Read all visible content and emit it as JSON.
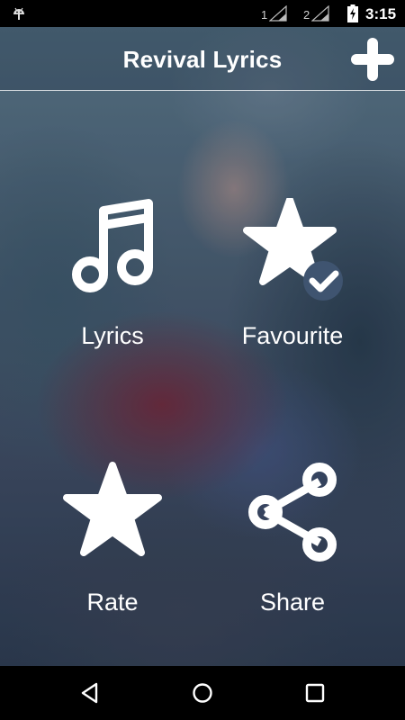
{
  "status_bar": {
    "sim1_label": "1",
    "sim2_label": "2",
    "time": "3:15",
    "icons": [
      "android-notification-icon",
      "signal-icon",
      "signal-icon",
      "battery-charging-icon"
    ]
  },
  "app_bar": {
    "title": "Revival Lyrics",
    "action_icon": "add-icon"
  },
  "menu": {
    "lyrics": {
      "label": "Lyrics",
      "icon": "music-note-icon"
    },
    "favourite": {
      "label": "Favourite",
      "icon": "star-check-icon"
    },
    "rate": {
      "label": "Rate",
      "icon": "star-icon"
    },
    "share": {
      "label": "Share",
      "icon": "share-icon"
    }
  },
  "nav_bar": {
    "icons": [
      "back-icon",
      "home-icon",
      "recents-icon"
    ]
  },
  "colors": {
    "icon": "#ffffff",
    "text": "#ffffff",
    "status_bar": "#000000",
    "nav_bar": "#000000"
  }
}
